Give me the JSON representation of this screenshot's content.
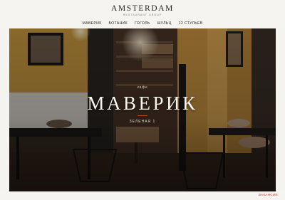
{
  "header": {
    "logo_title": "AMSTERDAM",
    "logo_sub": "RESTAURANT GROUP"
  },
  "nav": {
    "items": [
      {
        "label": "Маверик"
      },
      {
        "label": "Ботаник"
      },
      {
        "label": "Гоголь"
      },
      {
        "label": "Шульц"
      },
      {
        "label": "12 Стульев"
      }
    ]
  },
  "hero": {
    "eyebrow": "кафе",
    "title": "МАВЕРИК",
    "subtitle": "Зеленая 1"
  },
  "footer": {
    "link_label": "Вакансии"
  },
  "colors": {
    "accent": "#c0392b",
    "background": "#f6f4f0",
    "wall_mustard": "#c99a44",
    "dark": "#2a2420"
  }
}
